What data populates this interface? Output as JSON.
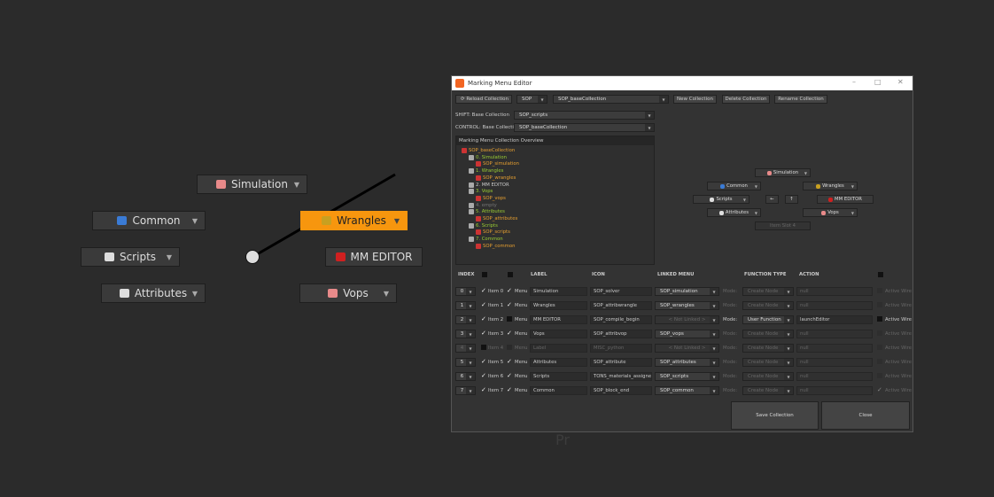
{
  "marking_menu": {
    "items": [
      {
        "label": "Simulation",
        "icon": "simulation-icon",
        "color": "#e88a8a"
      },
      {
        "label": "Common",
        "icon": "common-icon",
        "color": "#3a7bd5"
      },
      {
        "label": "Wrangles",
        "icon": "wrangles-icon",
        "color": "#c8a020",
        "active": true
      },
      {
        "label": "Scripts",
        "icon": "scripts-icon",
        "color": "#dddddd"
      },
      {
        "label": "MM EDITOR",
        "icon": "mm-editor-icon",
        "color": "#d02020"
      },
      {
        "label": "Attributes",
        "icon": "attributes-icon",
        "color": "#dddddd"
      },
      {
        "label": "Vops",
        "icon": "vops-icon",
        "color": "#e88a8a"
      }
    ],
    "accent": "#f7960e"
  },
  "window": {
    "title": "Marking Menu Editor",
    "toolbar": {
      "reload": "Reload Collection",
      "context": "SOP",
      "collection": "SOP_baseCollection",
      "new": "New Collection",
      "delete": "Delete Collection",
      "rename": "Rename Collection"
    },
    "shift_label": "SHIFT: Base Collection",
    "shift_value": "SOP_scripts",
    "control_label": "CONTROL: Base Collection",
    "control_value": "SOP_baseCollection",
    "tree": {
      "header": "Marking Menu Collection Overview",
      "items": [
        {
          "text": "SOP_baseCollection",
          "level": 0,
          "color": "#e8a030"
        },
        {
          "text": "0. Simulation",
          "level": 1,
          "color": "#9acd32"
        },
        {
          "text": "SOP_simulation",
          "level": 2,
          "color": "#e8a030"
        },
        {
          "text": "1. Wrangles",
          "level": 1,
          "color": "#9acd32"
        },
        {
          "text": "SOP_wrangles",
          "level": 2,
          "color": "#e8a030"
        },
        {
          "text": "2. MM EDITOR",
          "level": 1,
          "color": "#cccccc"
        },
        {
          "text": "3. Vops",
          "level": 1,
          "color": "#9acd32"
        },
        {
          "text": "SOP_vops",
          "level": 2,
          "color": "#e8a030"
        },
        {
          "text": "4. empty",
          "level": 1,
          "color": "#777777"
        },
        {
          "text": "5. Attributes",
          "level": 1,
          "color": "#9acd32"
        },
        {
          "text": "SOP_attributes",
          "level": 2,
          "color": "#e8a030"
        },
        {
          "text": "6. Scripts",
          "level": 1,
          "color": "#9acd32"
        },
        {
          "text": "SOP_scripts",
          "level": 2,
          "color": "#e8a030"
        },
        {
          "text": "7. Common",
          "level": 1,
          "color": "#9acd32"
        },
        {
          "text": "SOP_common",
          "level": 2,
          "color": "#e8a030"
        }
      ]
    },
    "preview": {
      "items": [
        "Simulation",
        "Common",
        "Wrangles",
        "Scripts",
        "MM EDITOR",
        "Attributes",
        "Vops"
      ],
      "slot4": "Item Slot 4"
    },
    "headers": {
      "index": "INDEX",
      "label": "LABEL",
      "icon": "ICON",
      "linked": "LINKED MENU",
      "function": "FUNCTION TYPE",
      "action": "ACTION"
    },
    "rows": [
      {
        "index": "0",
        "item": "Item 0",
        "item_on": true,
        "menu": "Menu",
        "menu_on": true,
        "label": "Simulation",
        "icon": "SOP_solver",
        "linked": "SOP_simulation",
        "mode": "Mode:",
        "function": "Create Node",
        "action": "null",
        "wire": "Active Wire",
        "wire_on": false,
        "enabled": true,
        "userfn": false
      },
      {
        "index": "1",
        "item": "Item 1",
        "item_on": true,
        "menu": "Menu",
        "menu_on": true,
        "label": "Wrangles",
        "icon": "SOP_attribwrangle",
        "linked": "SOP_wrangles",
        "mode": "Mode:",
        "function": "Create Node",
        "action": "null",
        "wire": "Active Wire",
        "wire_on": false,
        "enabled": true,
        "userfn": false
      },
      {
        "index": "2",
        "item": "Item 2",
        "item_on": true,
        "menu": "Menu",
        "menu_on": false,
        "label": "MM EDITOR",
        "icon": "SOP_compile_begin",
        "linked": "< Not Linked >",
        "mode": "Mode:",
        "function": "User Function",
        "action": "launchEditor",
        "wire": "Active Wire",
        "wire_on": false,
        "enabled": true,
        "userfn": true
      },
      {
        "index": "3",
        "item": "Item 3",
        "item_on": true,
        "menu": "Menu",
        "menu_on": true,
        "label": "Vops",
        "icon": "SOP_attribvop",
        "linked": "SOP_vops",
        "mode": "Mode:",
        "function": "Create Node",
        "action": "null",
        "wire": "Active Wire",
        "wire_on": false,
        "enabled": true,
        "userfn": false
      },
      {
        "index": "4",
        "item": "Item 4",
        "item_on": false,
        "menu": "Menu",
        "menu_on": false,
        "label": "Label",
        "icon": "MISC_python",
        "linked": "< Not Linked >",
        "mode": "Mode:",
        "function": "Create Node",
        "action": "null",
        "wire": "Active Wire",
        "wire_on": false,
        "enabled": false,
        "userfn": false
      },
      {
        "index": "5",
        "item": "Item 5",
        "item_on": true,
        "menu": "Menu",
        "menu_on": true,
        "label": "Attributes",
        "icon": "SOP_attribute",
        "linked": "SOP_attributes",
        "mode": "Mode:",
        "function": "Create Node",
        "action": "null",
        "wire": "Active Wire",
        "wire_on": false,
        "enabled": true,
        "userfn": false
      },
      {
        "index": "6",
        "item": "Item 6",
        "item_on": true,
        "menu": "Menu",
        "menu_on": true,
        "label": "Scripts",
        "icon": "TONS_materials_assigned",
        "linked": "SOP_scripts",
        "mode": "Mode:",
        "function": "Create Node",
        "action": "null",
        "wire": "Active Wire",
        "wire_on": false,
        "enabled": true,
        "userfn": false
      },
      {
        "index": "7",
        "item": "Item 7",
        "item_on": true,
        "menu": "Menu",
        "menu_on": true,
        "label": "Common",
        "icon": "SOP_block_end",
        "linked": "SOP_common",
        "mode": "Mode:",
        "function": "Create Node",
        "action": "null",
        "wire": "Active Wire",
        "wire_on": true,
        "enabled": true,
        "userfn": false
      }
    ],
    "save": "Save Collection",
    "close": "Close"
  },
  "watermark": "Pr"
}
